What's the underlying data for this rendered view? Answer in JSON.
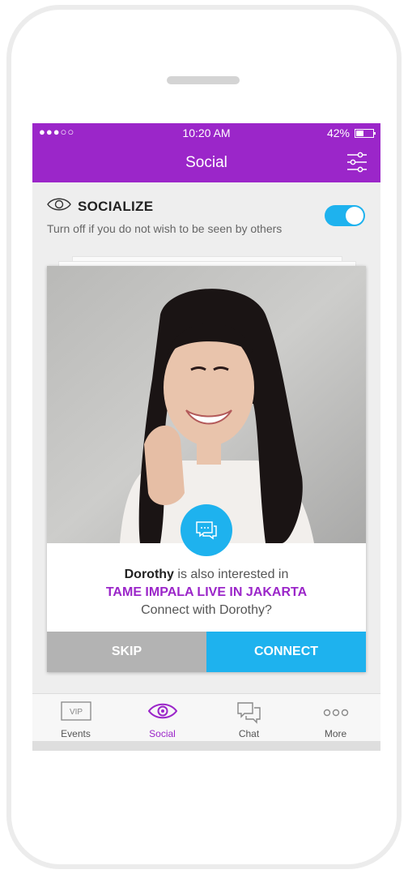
{
  "status_bar": {
    "signal": "●●●○○",
    "time": "10:20 AM",
    "battery": "42%"
  },
  "header": {
    "title": "Social",
    "filter_icon": "sliders-icon"
  },
  "socialize": {
    "label": "SOCIALIZE",
    "description": "Turn off if you do not wish to be seen by others",
    "enabled": true,
    "icon": "eye-icon"
  },
  "card": {
    "name": "Dorothy",
    "interest_text": " is also interested in",
    "event": "TAME IMPALA LIVE IN JAKARTA",
    "question": "Connect with Dorothy?",
    "skip_label": "SKIP",
    "connect_label": "CONNECT"
  },
  "tabs": [
    {
      "label": "Events",
      "icon": "vip-ticket-icon",
      "active": false
    },
    {
      "label": "Social",
      "icon": "eye-icon",
      "active": true
    },
    {
      "label": "Chat",
      "icon": "chat-bubbles-icon",
      "active": false
    },
    {
      "label": "More",
      "icon": "more-dots-icon",
      "active": false
    }
  ],
  "colors": {
    "brand_purple": "#9b26c9",
    "accent_blue": "#1eb2ee",
    "skip_gray": "#b3b3b3"
  }
}
